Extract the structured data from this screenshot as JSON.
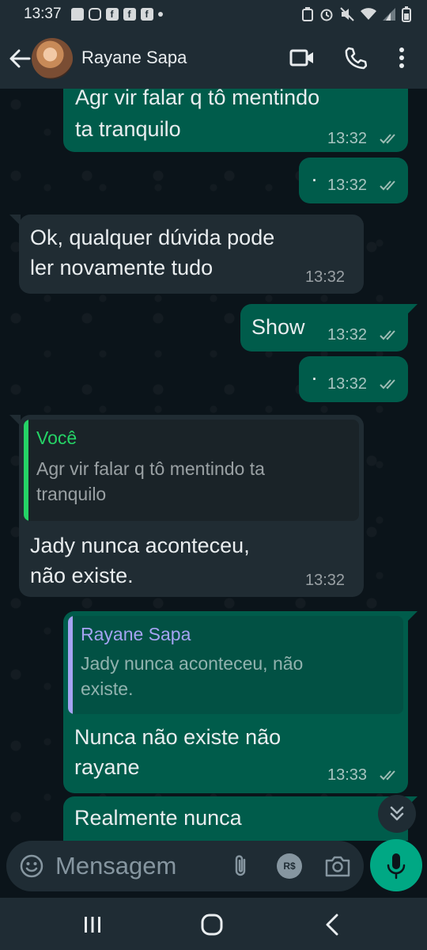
{
  "status_bar": {
    "time": "13:37",
    "left_icons": [
      "message-icon",
      "instagram-icon",
      "facebook-icon",
      "facebook-icon",
      "facebook-icon",
      "dot-icon"
    ],
    "right_icons": [
      "battery-saver-icon",
      "alarm-icon",
      "mute-icon",
      "wifi-icon",
      "signal-icon",
      "battery-icon"
    ]
  },
  "header": {
    "contact_name": "Rayane Sapa"
  },
  "messages": [
    {
      "direction": "out",
      "text_lines": [
        "Agr vir falar q tô mentindo",
        "ta tranquilo"
      ],
      "time": "13:32",
      "status": "read"
    },
    {
      "direction": "out",
      "text_lines": [
        "·"
      ],
      "time": "13:32",
      "status": "read"
    },
    {
      "direction": "in",
      "text_lines": [
        "Ok, qualquer dúvida pode",
        "ler novamente tudo"
      ],
      "time": "13:32"
    },
    {
      "direction": "out",
      "text_lines": [
        "Show"
      ],
      "time": "13:32",
      "status": "read"
    },
    {
      "direction": "out",
      "text_lines": [
        "·"
      ],
      "time": "13:32",
      "status": "read"
    },
    {
      "direction": "in",
      "quote": {
        "author": "Você",
        "text_lines": [
          "Agr vir falar q tô mentindo ta",
          "tranquilo"
        ]
      },
      "text_lines": [
        "Jady nunca aconteceu,",
        "não existe."
      ],
      "time": "13:32"
    },
    {
      "direction": "out",
      "quote": {
        "author": "Rayane Sapa",
        "text_lines": [
          "Jady nunca aconteceu, não",
          "existe."
        ]
      },
      "text_lines": [
        "Nunca não existe não",
        "rayane"
      ],
      "time": "13:33",
      "status": "read"
    },
    {
      "direction": "out",
      "text_lines": [
        "Realmente nunca"
      ]
    }
  ],
  "composer": {
    "placeholder": "Mensagem",
    "pay_label": "R$"
  },
  "colors": {
    "outgoing_bubble": "#005c4b",
    "incoming_bubble": "#202c33",
    "accent_green": "#00a884",
    "quote_you": "#25d366",
    "quote_contact": "#a5a3f2",
    "read_ticks": "#9ebdb5"
  }
}
